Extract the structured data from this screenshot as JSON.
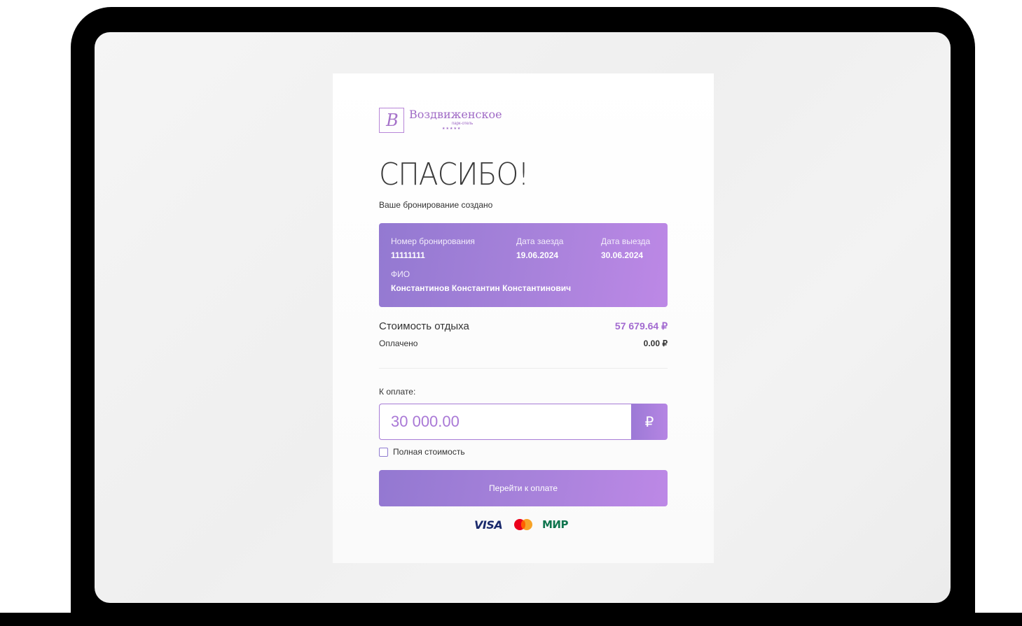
{
  "brand": {
    "logo_letter": "B",
    "name": "Воздвиженское",
    "subtitle": "парк-отель",
    "stars": "★★★★★"
  },
  "title": "СПАСИБО!",
  "subtitle": "Ваше бронирование создано",
  "booking": {
    "number_label": "Номер бронирования",
    "number_value": "11111111",
    "checkin_label": "Дата заезда",
    "checkin_value": "19.06.2024",
    "checkout_label": "Дата выезда",
    "checkout_value": "30.06.2024",
    "name_label": "ФИО",
    "name_value": "Константинов Константин Константинович"
  },
  "cost": {
    "label": "Стоимость отдыха",
    "value": "57 679.64 ₽",
    "paid_label": "Оплачено",
    "paid_value": "0.00 ₽"
  },
  "payment": {
    "label": "К оплате:",
    "amount": "30 000.00",
    "currency": "₽",
    "full_cost_label": "Полная стоимость",
    "full_cost_checked": false,
    "button_label": "Перейти к оплате"
  },
  "payment_systems": {
    "visa": "VISA",
    "mir": "МИР"
  },
  "colors": {
    "accent": "#a882db",
    "accent_text": "#a26ad0",
    "mir_green": "#0f754e",
    "visa_blue": "#1a2a6c"
  }
}
